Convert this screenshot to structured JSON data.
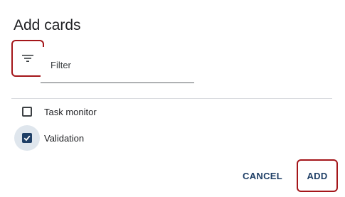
{
  "dialog": {
    "title": "Add cards"
  },
  "filter": {
    "icon": "filter-list-icon",
    "placeholder": "Filter",
    "value": ""
  },
  "options": [
    {
      "label": "Task monitor",
      "checked": false
    },
    {
      "label": "Validation",
      "checked": true
    }
  ],
  "actions": {
    "cancel_label": "CANCEL",
    "add_label": "ADD"
  },
  "colors": {
    "accent": "#1f3f66",
    "highlight_border": "#a4161a"
  }
}
